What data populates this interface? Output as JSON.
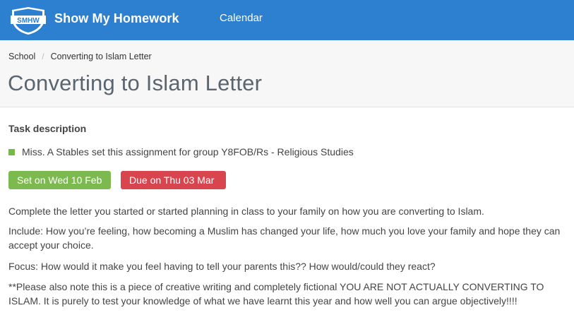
{
  "header": {
    "logo_text": "SMHW",
    "brand": "Show My Homework",
    "nav": {
      "calendar": "Calendar"
    }
  },
  "breadcrumb": {
    "items": [
      "School",
      "Converting to Islam Letter"
    ],
    "separator": "/"
  },
  "page": {
    "title": "Converting to Islam Letter"
  },
  "task": {
    "heading": "Task description",
    "assignment": "Miss. A Stables set this assignment for group Y8FOB/Rs - Religious Studies",
    "set_on": "Set on Wed 10 Feb",
    "due_on": "Due on Thu 03 Mar",
    "description": [
      "Complete the letter you started or started planning in class to your family on how you are converting to Islam.",
      "Include: How you’re feeling, how becoming a Muslim has changed your life, how much you love your family and hope they can accept your choice.",
      "Focus: How would it make you feel having to tell your parents this?? How would/could they react?",
      "**Please also note this is a piece of creative writing and completely fictional YOU ARE NOT ACTUALLY CONVERTING TO ISLAM. It is purely to test your knowledge of what we have learnt this year and how well you can argue objectively!!!!"
    ]
  },
  "colors": {
    "topbar": "#2d7fd0",
    "set_badge": "#7cba4f",
    "due_badge": "#d9454f",
    "group_marker": "#78b84b"
  }
}
